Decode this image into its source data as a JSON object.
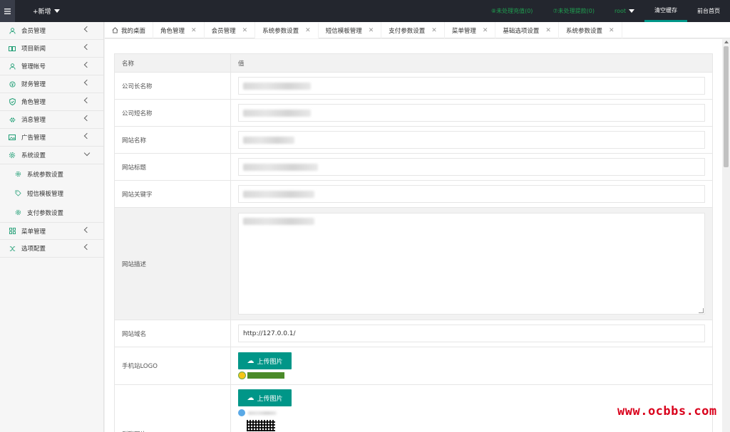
{
  "topbar": {
    "add_new": "+新增",
    "pending_recharge": "⑧未处理充值(0)",
    "pending_withdraw": "⑦未处理提款(0)",
    "user": "root",
    "clear_cache": "清空缓存",
    "front_home": "前台首页"
  },
  "sidebar": {
    "items": [
      {
        "label": "会员管理",
        "icon": "user-icon"
      },
      {
        "label": "项目新闻",
        "icon": "book-icon"
      },
      {
        "label": "管理帐号",
        "icon": "user-icon"
      },
      {
        "label": "财务管理",
        "icon": "money-icon"
      },
      {
        "label": "角色管理",
        "icon": "shield-icon"
      },
      {
        "label": "消息管理",
        "icon": "message-icon"
      },
      {
        "label": "广告管理",
        "icon": "image-icon"
      },
      {
        "label": "系统设置",
        "icon": "gear-icon"
      }
    ],
    "subitems": [
      {
        "label": "系统参数设置"
      },
      {
        "label": "短信模板管理"
      },
      {
        "label": "支付参数设置"
      }
    ],
    "items_after": [
      {
        "label": "菜单管理",
        "icon": "grid-icon"
      },
      {
        "label": "选项配置",
        "icon": "shuffle-icon"
      }
    ]
  },
  "tabs": [
    {
      "label": "我的桌面"
    },
    {
      "label": "角色管理"
    },
    {
      "label": "会员管理"
    },
    {
      "label": "系统参数设置"
    },
    {
      "label": "短信模板管理"
    },
    {
      "label": "支付参数设置"
    },
    {
      "label": "菜单管理"
    },
    {
      "label": "基础选项设置"
    },
    {
      "label": "系统参数设置"
    }
  ],
  "table": {
    "col_name": "名称",
    "col_value": "值",
    "rows": [
      {
        "label": "公司长名称"
      },
      {
        "label": "公司短名称"
      },
      {
        "label": "网站名称"
      },
      {
        "label": "网站标题"
      },
      {
        "label": "网站关键字"
      },
      {
        "label": "网站描述"
      },
      {
        "label": "网站域名",
        "value": "http://127.0.0.1/"
      },
      {
        "label": "手机站LOGO"
      },
      {
        "label": "群聊图片"
      }
    ],
    "upload_label": "上传图片"
  },
  "watermark": "www.ocbbs.com"
}
